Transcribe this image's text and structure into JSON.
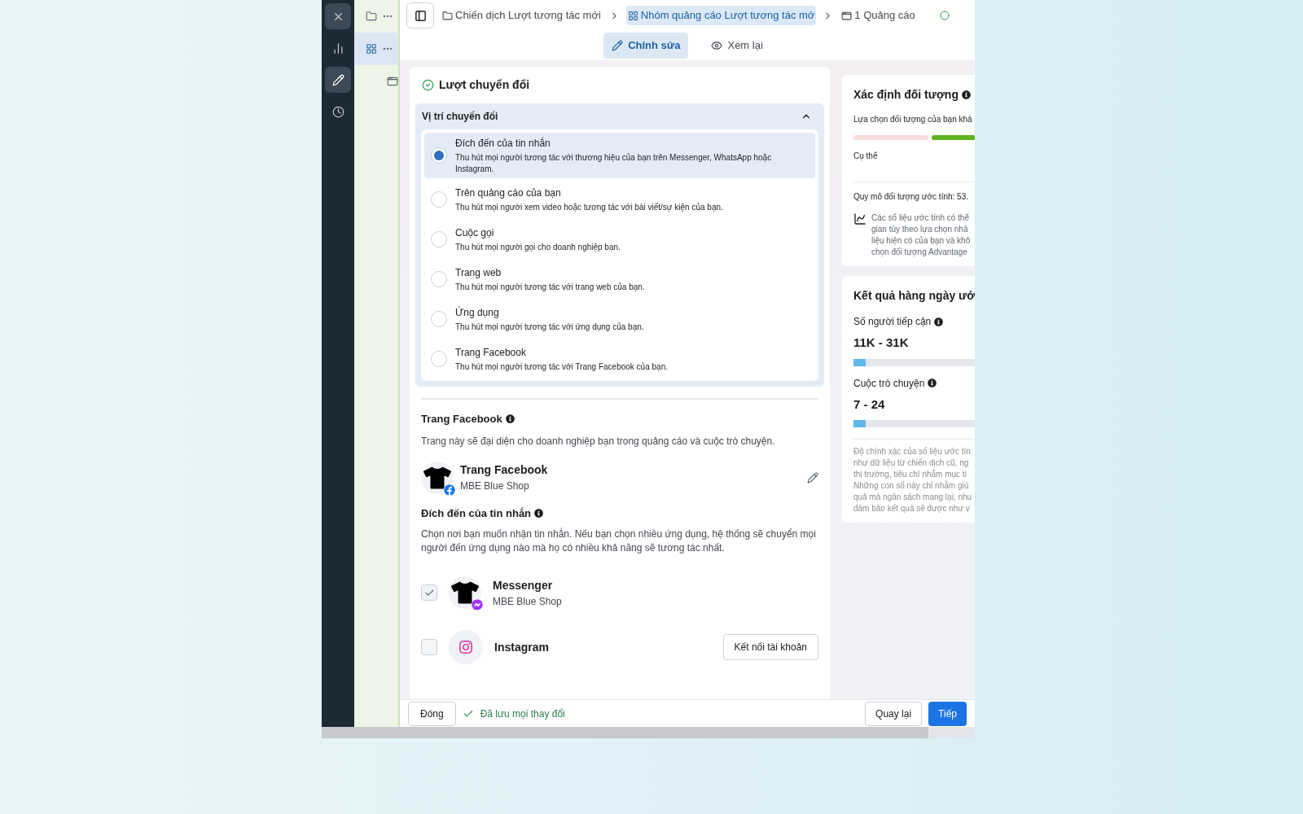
{
  "sidebar": {
    "icons": [
      {
        "kind": "close",
        "selected": false
      },
      {
        "kind": "chart",
        "selected": false
      },
      {
        "kind": "edit",
        "selected": true
      },
      {
        "kind": "history",
        "selected": false
      }
    ]
  },
  "tree": {
    "items": [
      {
        "kind": "campaign",
        "selected": false
      },
      {
        "kind": "adset",
        "selected": true
      },
      {
        "kind": "ad",
        "selected": false
      }
    ]
  },
  "breadcrumb": [
    {
      "kind": "campaign",
      "label": "Chiến dịch Lượt tương tác mới",
      "selected": false
    },
    {
      "kind": "adset",
      "label": "Nhóm quảng cáo Lượt tương tác mớ",
      "selected": true
    },
    {
      "kind": "ad",
      "label": "1 Quảng cáo",
      "selected": false
    }
  ],
  "mode_tabs": [
    {
      "kind": "edit",
      "label": "Chỉnh sửa",
      "selected": true
    },
    {
      "kind": "preview",
      "label": "Xem lại",
      "selected": false
    }
  ],
  "objective": {
    "title": "Lượt chuyển đổi"
  },
  "conversion_location": {
    "title": "Vị trí chuyển đổi",
    "expanded": true,
    "options": [
      {
        "label": "Đích đến của tin nhắn",
        "description": "Thu hút mọi người tương tác với thương hiệu của bạn trên Messenger, WhatsApp hoặc Instagram.",
        "selected": true
      },
      {
        "label": "Trên quảng cáo của bạn",
        "description": "Thu hút mọi người xem video hoặc tương tác với bài viết/sự kiện của bạn.",
        "selected": false
      },
      {
        "label": "Cuộc gọi",
        "description": "Thu hút mọi người gọi cho doanh nghiệp bạn.",
        "selected": false
      },
      {
        "label": "Trang web",
        "description": "Thu hút mọi người tương tác với trang web của bạn.",
        "selected": false
      },
      {
        "label": "Ứng dụng",
        "description": "Thu hút mọi người tương tác với ứng dụng của bạn.",
        "selected": false
      },
      {
        "label": "Trang Facebook",
        "description": "Thu hút mọi người tương tác với Trang Facebook của bạn.",
        "selected": false
      }
    ]
  },
  "facebook_page": {
    "title": "Trang Facebook",
    "description": "Trang này sẽ đại diện cho doanh nghiệp bạn trong quảng cáo và cuộc trò chuyện.",
    "name": "Trang Facebook",
    "account": "MBE Blue Shop"
  },
  "message_destinations": {
    "title": "Đích đến của tin nhắn",
    "description": "Chọn nơi bạn muốn nhận tin nhắn. Nếu bạn chọn nhiều ứng dụng, hệ thống sẽ chuyển mọi người đến ứng dụng nào mà họ có nhiều khả năng sẽ tương tác nhất.",
    "apps": [
      {
        "kind": "messenger",
        "name": "Messenger",
        "account": "MBE Blue Shop",
        "checked": true
      },
      {
        "kind": "instagram",
        "name": "Instagram",
        "checked": false,
        "action": "Kết nối tài khoản"
      }
    ]
  },
  "audience": {
    "title": "Xác định đối tượng",
    "summary": "Lựa chọn đối tượng của bạn khá",
    "meter_label": "Cụ thể",
    "size": "Quy mô đối tượng ước tính: 53.",
    "note_lines": [
      "Các số liệu ước tính có thể",
      "gian tùy theo lựa chọn nhâ",
      "liệu hiện có của bạn và khô",
      "chọn đối tượng Advantage"
    ]
  },
  "daily_results": {
    "title": "Kết quả hàng ngày ướ",
    "metrics": [
      {
        "label": "Số người tiếp cận",
        "value": "11K - 31K",
        "level": 0.1
      },
      {
        "label": "Cuộc trò chuyện",
        "value": "7 - 24",
        "level": 0.1
      }
    ],
    "note_lines": [
      "Độ chính xác của số liệu ước tín",
      "như dữ liệu từ chiến dịch cũ, ng",
      "thị trường, tiêu chí nhắm mục ti",
      "Những con số này chỉ nhằm giú",
      "quả mà ngân sách mang lại, nhu",
      "đảm bảo kết quả sẽ được như v"
    ]
  },
  "footer": {
    "close": "Đóng",
    "status": "Đã lưu mọi thay đổi",
    "back": "Quay lại",
    "next": "Tiếp"
  }
}
